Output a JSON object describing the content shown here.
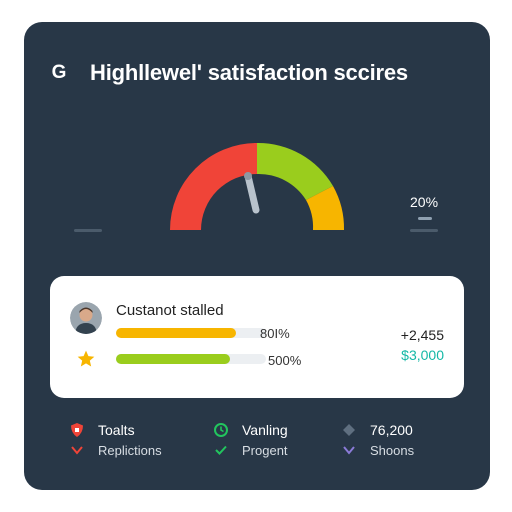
{
  "header": {
    "logo_letter": "G",
    "title": "Highllewel' satisfaction sccires"
  },
  "gauge": {
    "right_percent": "20%",
    "segment_colors": {
      "red": "#f04438",
      "green": "#9acd1d",
      "yellow": "#f7b500"
    },
    "needle_color": "#b8c2cc"
  },
  "panel": {
    "customer_label": "Custanot stalled",
    "bars": [
      {
        "percent_label": "80I%",
        "fill_fraction": 0.8,
        "color": "#f7b500"
      },
      {
        "percent_label": "500%",
        "fill_fraction": 0.76,
        "color": "#9acd1d"
      }
    ],
    "right_values": [
      {
        "text": "+2,455",
        "color": "#222222"
      },
      {
        "text": "$3,000",
        "color": "#14b8a6"
      }
    ]
  },
  "legend": {
    "col1": {
      "main": "Toalts",
      "sub": "Replictions"
    },
    "col2": {
      "main": "Vanling",
      "sub": "Progent"
    },
    "col3": {
      "main": "76,200",
      "sub": "Shoons"
    }
  },
  "colors": {
    "card_bg": "#283747",
    "accent_red": "#f04438",
    "accent_green": "#22c55e",
    "accent_purple": "#8b7bd8"
  }
}
